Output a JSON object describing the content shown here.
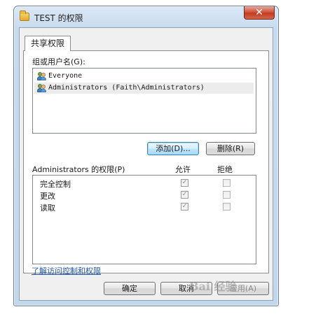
{
  "window": {
    "title": "TEST 的权限",
    "close_label": "✕"
  },
  "tab": {
    "label": "共享权限"
  },
  "users_section": {
    "label": "组或用户名(G):",
    "items": [
      {
        "name": "Everyone",
        "selected": false
      },
      {
        "name": "Administrators (Faith\\Administrators)",
        "selected": true
      }
    ]
  },
  "buttons": {
    "add": "添加(D)...",
    "remove": "删除(R)",
    "ok": "确定",
    "cancel": "取消",
    "apply": "应用(A)"
  },
  "permissions": {
    "label": "Administrators 的权限(P)",
    "allow_header": "允许",
    "deny_header": "拒绝",
    "rows": [
      {
        "name": "完全控制",
        "allow": true,
        "deny": false
      },
      {
        "name": "更改",
        "allow": true,
        "deny": false
      },
      {
        "name": "读取",
        "allow": true,
        "deny": false
      }
    ]
  },
  "link": {
    "text": "了解访问控制和权限"
  },
  "watermark": {
    "text": "Bai 经验"
  },
  "colors": {
    "link": "#1f58b0",
    "close_button": "#c13b1f",
    "selection": "#ececec"
  }
}
